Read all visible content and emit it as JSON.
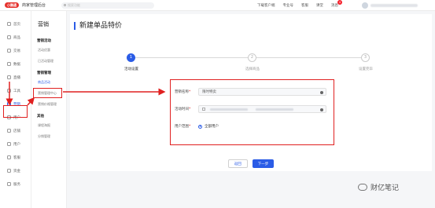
{
  "topbar": {
    "logo": "小鹅通",
    "app_title": "商家管理后台",
    "search_placeholder": "搜索功能",
    "links": [
      "下载客户端",
      "专业号",
      "客服",
      "课堂",
      "消息"
    ],
    "message_badge": "4"
  },
  "leftnav": {
    "items": [
      {
        "label": "首页",
        "icon": "home-icon"
      },
      {
        "label": "商品",
        "icon": "goods-icon"
      },
      {
        "label": "交易",
        "icon": "trade-icon"
      },
      {
        "label": "数据",
        "icon": "data-icon"
      },
      {
        "label": "直播",
        "icon": "live-icon"
      },
      {
        "label": "工具",
        "icon": "tool-icon"
      },
      {
        "label": "营销",
        "icon": "marketing-icon"
      },
      {
        "label": "用户",
        "icon": "user-icon"
      },
      {
        "label": "店铺",
        "icon": "shop-icon"
      },
      {
        "label": "用户",
        "icon": "users-icon"
      },
      {
        "label": "客服",
        "icon": "service-icon"
      },
      {
        "label": "资金",
        "icon": "fund-icon"
      },
      {
        "label": "服务",
        "icon": "service2-icon"
      }
    ],
    "active_index": 6
  },
  "subnav": {
    "title": "营销",
    "group1": "营销活动",
    "g1_items": [
      "活动优惠",
      "已活动管理"
    ],
    "group2": "营销管理",
    "g2_items": [
      "商品活动",
      "营销管理中心",
      "营销价格管理"
    ],
    "group3": "其他",
    "g3_items": [
      "课程海报",
      "分销管理"
    ]
  },
  "main": {
    "page_title": "新建单品特价",
    "steps": [
      {
        "num": "1",
        "label": "活动设置"
      },
      {
        "num": "2",
        "label": "选择商品"
      },
      {
        "num": "3",
        "label": "设置完毕"
      }
    ],
    "form": {
      "name_label": "营销名称",
      "name_value": "限时特卖",
      "time_label": "活动时间",
      "users_label": "用户范围",
      "users_option": "全部用户",
      "required_mark": "*"
    },
    "back_button": "返回",
    "next_button": "下一步"
  },
  "watermark": "财亿笔记",
  "colors": {
    "accent": "#2b5ce6",
    "annotation": "#e02020"
  }
}
